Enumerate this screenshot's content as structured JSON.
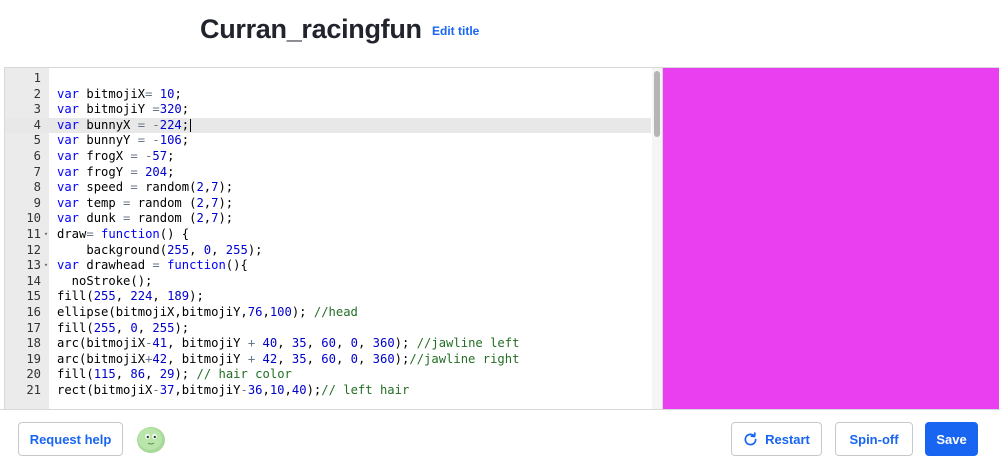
{
  "header": {
    "title": "Curran_racingfun",
    "edit_title_label": "Edit title"
  },
  "editor": {
    "active_line": 4,
    "lines": [
      {
        "num": "1",
        "fold": false,
        "tokens": []
      },
      {
        "num": "2",
        "fold": false,
        "tokens": [
          [
            "kw",
            "var"
          ],
          [
            "t",
            " bitmojiX"
          ],
          [
            "op",
            "="
          ],
          [
            "t",
            " "
          ],
          [
            "num",
            "10"
          ],
          [
            "t",
            ";"
          ]
        ]
      },
      {
        "num": "3",
        "fold": false,
        "tokens": [
          [
            "kw",
            "var"
          ],
          [
            "t",
            " bitmojiY "
          ],
          [
            "op",
            "="
          ],
          [
            "num",
            "320"
          ],
          [
            "t",
            ";"
          ]
        ]
      },
      {
        "num": "4",
        "fold": false,
        "cursor": true,
        "tokens": [
          [
            "kw",
            "var"
          ],
          [
            "t",
            " bunnyX "
          ],
          [
            "op",
            "="
          ],
          [
            "t",
            " "
          ],
          [
            "op",
            "-"
          ],
          [
            "num",
            "224"
          ],
          [
            "t",
            ";"
          ]
        ]
      },
      {
        "num": "5",
        "fold": false,
        "tokens": [
          [
            "kw",
            "var"
          ],
          [
            "t",
            " bunnyY "
          ],
          [
            "op",
            "="
          ],
          [
            "t",
            " "
          ],
          [
            "op",
            "-"
          ],
          [
            "num",
            "106"
          ],
          [
            "t",
            ";"
          ]
        ]
      },
      {
        "num": "6",
        "fold": false,
        "tokens": [
          [
            "kw",
            "var"
          ],
          [
            "t",
            " frogX "
          ],
          [
            "op",
            "="
          ],
          [
            "t",
            " "
          ],
          [
            "op",
            "-"
          ],
          [
            "num",
            "57"
          ],
          [
            "t",
            ";"
          ]
        ]
      },
      {
        "num": "7",
        "fold": false,
        "tokens": [
          [
            "kw",
            "var"
          ],
          [
            "t",
            " frogY "
          ],
          [
            "op",
            "="
          ],
          [
            "t",
            " "
          ],
          [
            "num",
            "204"
          ],
          [
            "t",
            ";"
          ]
        ]
      },
      {
        "num": "8",
        "fold": false,
        "tokens": [
          [
            "kw",
            "var"
          ],
          [
            "t",
            " speed "
          ],
          [
            "op",
            "="
          ],
          [
            "t",
            " random("
          ],
          [
            "num",
            "2"
          ],
          [
            "t",
            ","
          ],
          [
            "num",
            "7"
          ],
          [
            "t",
            ");"
          ]
        ]
      },
      {
        "num": "9",
        "fold": false,
        "tokens": [
          [
            "kw",
            "var"
          ],
          [
            "t",
            " temp "
          ],
          [
            "op",
            "="
          ],
          [
            "t",
            " random ("
          ],
          [
            "num",
            "2"
          ],
          [
            "t",
            ","
          ],
          [
            "num",
            "7"
          ],
          [
            "t",
            ");"
          ]
        ]
      },
      {
        "num": "10",
        "fold": false,
        "tokens": [
          [
            "kw",
            "var"
          ],
          [
            "t",
            " dunk "
          ],
          [
            "op",
            "="
          ],
          [
            "t",
            " random ("
          ],
          [
            "num",
            "2"
          ],
          [
            "t",
            ","
          ],
          [
            "num",
            "7"
          ],
          [
            "t",
            ");"
          ]
        ]
      },
      {
        "num": "11",
        "fold": true,
        "tokens": [
          [
            "t",
            "draw"
          ],
          [
            "op",
            "="
          ],
          [
            "t",
            " "
          ],
          [
            "kw",
            "function"
          ],
          [
            "t",
            "() {"
          ]
        ]
      },
      {
        "num": "12",
        "fold": false,
        "tokens": [
          [
            "t",
            "    background("
          ],
          [
            "num",
            "255"
          ],
          [
            "t",
            ", "
          ],
          [
            "num",
            "0"
          ],
          [
            "t",
            ", "
          ],
          [
            "num",
            "255"
          ],
          [
            "t",
            ");"
          ]
        ]
      },
      {
        "num": "13",
        "fold": true,
        "tokens": [
          [
            "kw",
            "var"
          ],
          [
            "t",
            " drawhead "
          ],
          [
            "op",
            "="
          ],
          [
            "t",
            " "
          ],
          [
            "kw",
            "function"
          ],
          [
            "t",
            "(){"
          ]
        ]
      },
      {
        "num": "14",
        "fold": false,
        "tokens": [
          [
            "t",
            "  noStroke();"
          ]
        ]
      },
      {
        "num": "15",
        "fold": false,
        "tokens": [
          [
            "t",
            "fill("
          ],
          [
            "num",
            "255"
          ],
          [
            "t",
            ", "
          ],
          [
            "num",
            "224"
          ],
          [
            "t",
            ", "
          ],
          [
            "num",
            "189"
          ],
          [
            "t",
            ");"
          ]
        ]
      },
      {
        "num": "16",
        "fold": false,
        "tokens": [
          [
            "t",
            "ellipse(bitmojiX,bitmojiY,"
          ],
          [
            "num",
            "76"
          ],
          [
            "t",
            ","
          ],
          [
            "num",
            "100"
          ],
          [
            "t",
            ");"
          ],
          [
            "t",
            " "
          ],
          [
            "cm",
            "//head"
          ]
        ]
      },
      {
        "num": "17",
        "fold": false,
        "tokens": [
          [
            "t",
            "fill("
          ],
          [
            "num",
            "255"
          ],
          [
            "t",
            ", "
          ],
          [
            "num",
            "0"
          ],
          [
            "t",
            ", "
          ],
          [
            "num",
            "255"
          ],
          [
            "t",
            ");"
          ]
        ]
      },
      {
        "num": "18",
        "fold": false,
        "tokens": [
          [
            "t",
            "arc(bitmojiX"
          ],
          [
            "op",
            "-"
          ],
          [
            "num",
            "41"
          ],
          [
            "t",
            ", bitmojiY "
          ],
          [
            "op",
            "+"
          ],
          [
            "t",
            " "
          ],
          [
            "num",
            "40"
          ],
          [
            "t",
            ", "
          ],
          [
            "num",
            "35"
          ],
          [
            "t",
            ", "
          ],
          [
            "num",
            "60"
          ],
          [
            "t",
            ", "
          ],
          [
            "num",
            "0"
          ],
          [
            "t",
            ", "
          ],
          [
            "num",
            "360"
          ],
          [
            "t",
            ");"
          ],
          [
            "t",
            " "
          ],
          [
            "cm",
            "//jawline left"
          ]
        ]
      },
      {
        "num": "19",
        "fold": false,
        "tokens": [
          [
            "t",
            "arc(bitmojiX"
          ],
          [
            "op",
            "+"
          ],
          [
            "num",
            "42"
          ],
          [
            "t",
            ", bitmojiY "
          ],
          [
            "op",
            "+"
          ],
          [
            "t",
            " "
          ],
          [
            "num",
            "42"
          ],
          [
            "t",
            ", "
          ],
          [
            "num",
            "35"
          ],
          [
            "t",
            ", "
          ],
          [
            "num",
            "60"
          ],
          [
            "t",
            ", "
          ],
          [
            "num",
            "0"
          ],
          [
            "t",
            ", "
          ],
          [
            "num",
            "360"
          ],
          [
            "t",
            ");"
          ],
          [
            "cm",
            "//jawline right"
          ]
        ]
      },
      {
        "num": "20",
        "fold": false,
        "tokens": [
          [
            "t",
            "fill("
          ],
          [
            "num",
            "115"
          ],
          [
            "t",
            ", "
          ],
          [
            "num",
            "86"
          ],
          [
            "t",
            ", "
          ],
          [
            "num",
            "29"
          ],
          [
            "t",
            ");"
          ],
          [
            "t",
            " "
          ],
          [
            "cm",
            "// hair color"
          ]
        ]
      },
      {
        "num": "21",
        "fold": false,
        "tokens": [
          [
            "t",
            "rect(bitmojiX"
          ],
          [
            "op",
            "-"
          ],
          [
            "num",
            "37"
          ],
          [
            "t",
            ",bitmojiY"
          ],
          [
            "op",
            "-"
          ],
          [
            "num",
            "36"
          ],
          [
            "t",
            ","
          ],
          [
            "num",
            "10"
          ],
          [
            "t",
            ","
          ],
          [
            "num",
            "40"
          ],
          [
            "t",
            ");"
          ],
          [
            "cm",
            "// left hair"
          ]
        ]
      }
    ]
  },
  "canvas": {
    "background": "#ea3ff0"
  },
  "footer": {
    "request_help_label": "Request help",
    "avatar_icon": "green-blob-avatar-icon",
    "restart_label": "Restart",
    "restart_icon": "restart-icon",
    "spinoff_label": "Spin-off",
    "save_label": "Save"
  },
  "colors": {
    "accent": "#1865f2",
    "canvas": "#ea3ff0"
  }
}
